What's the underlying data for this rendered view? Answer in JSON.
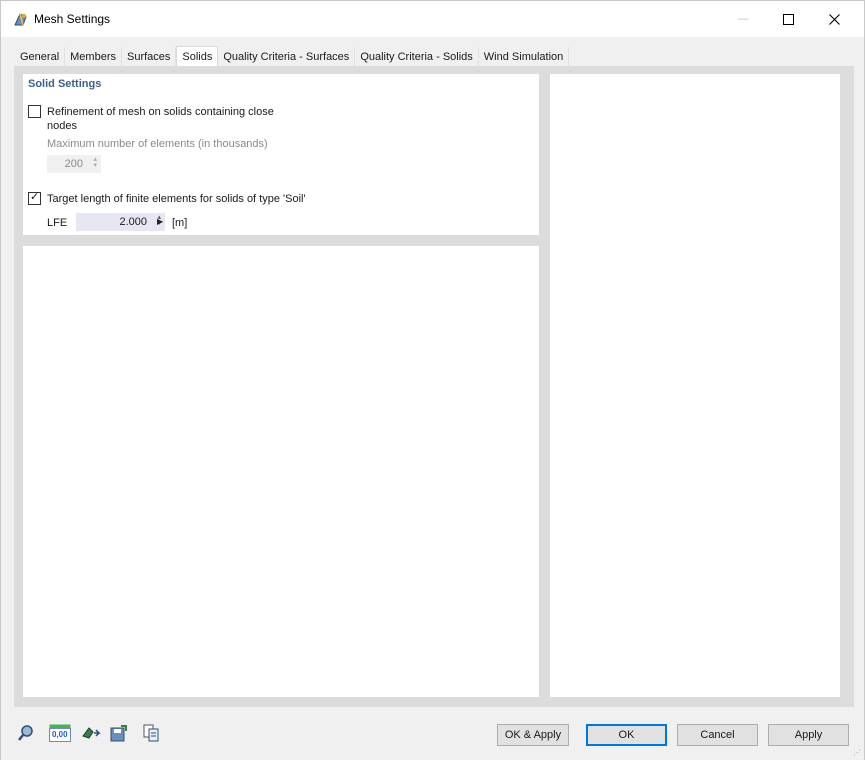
{
  "window": {
    "title": "Mesh Settings",
    "minimize_label": "—",
    "maximize_label": "☐",
    "close_label": "✕"
  },
  "tabs": [
    {
      "label": "General"
    },
    {
      "label": "Members"
    },
    {
      "label": "Surfaces"
    },
    {
      "label": "Solids",
      "active": true
    },
    {
      "label": "Quality Criteria - Surfaces"
    },
    {
      "label": "Quality Criteria - Solids"
    },
    {
      "label": "Wind Simulation"
    }
  ],
  "solid_settings": {
    "title": "Solid Settings",
    "refinement": {
      "checked": false,
      "label_line1": "Refinement of mesh on solids containing close",
      "label_line2": "nodes",
      "max_elements_label": "Maximum number of elements (in thousands)",
      "max_elements_value": "200"
    },
    "target_length": {
      "checked": true,
      "tick": "✓",
      "label": "Target length of finite elements for solids of type 'Soil'",
      "field_label": "LFE",
      "value": "2.000",
      "unit": "[m]"
    }
  },
  "footer": {
    "icons": [
      "search-zoom-icon",
      "numeric-display-icon",
      "model-arrow-icon",
      "save-settings-icon",
      "copy-table-icon"
    ],
    "numeric_icon_text": "0,00",
    "buttons": {
      "ok_apply": "OK & Apply",
      "ok": "OK",
      "cancel": "Cancel",
      "apply": "Apply"
    }
  },
  "colors": {
    "section_title": "#3e5f8a",
    "primary_border": "#0078d7",
    "panel_bg": "#ffffff",
    "content_bg": "#dcdcdc"
  }
}
